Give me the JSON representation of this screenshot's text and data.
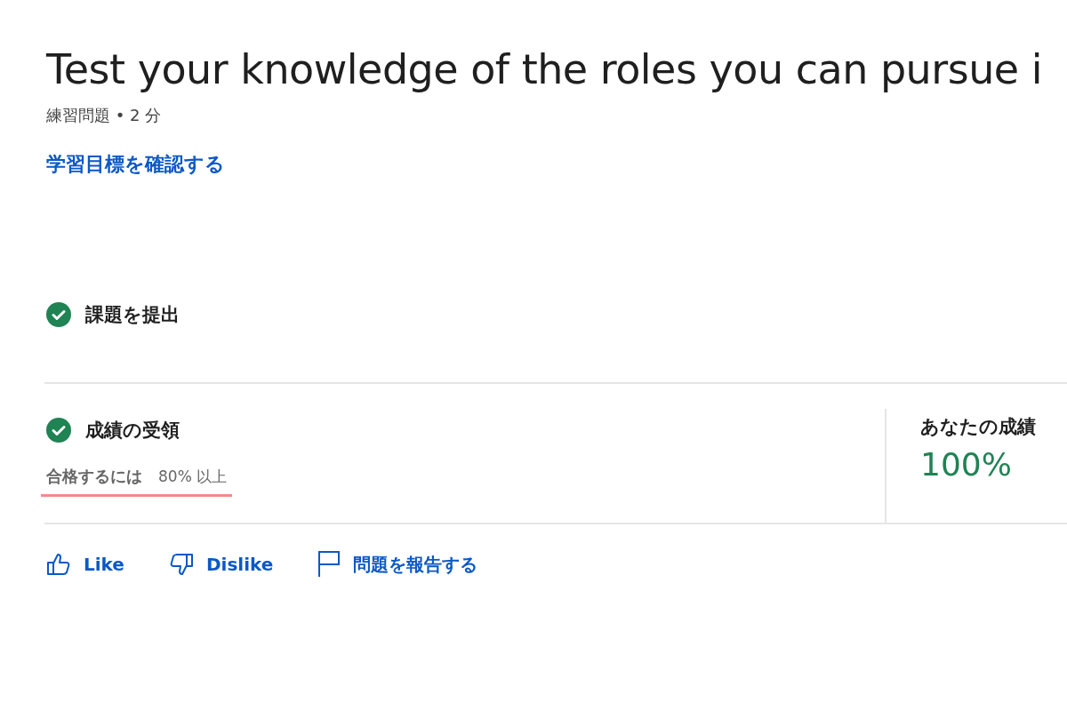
{
  "title": "Test your knowledge of the roles you can pursue i",
  "meta": "練習問題 • 2 分",
  "objectives_link": "学習目標を確認する",
  "steps": [
    {
      "label": "課題を提出",
      "checked": true
    },
    {
      "label": "成績の受領",
      "checked": true
    }
  ],
  "passing": {
    "label": "合格するには",
    "value": "80% 以上"
  },
  "grade": {
    "label": "あなたの成績",
    "value": "100%"
  },
  "feedback": [
    {
      "kind": "like",
      "label": "Like"
    },
    {
      "kind": "dislike",
      "label": "Dislike"
    },
    {
      "kind": "report",
      "label": "問題を報告する"
    }
  ]
}
